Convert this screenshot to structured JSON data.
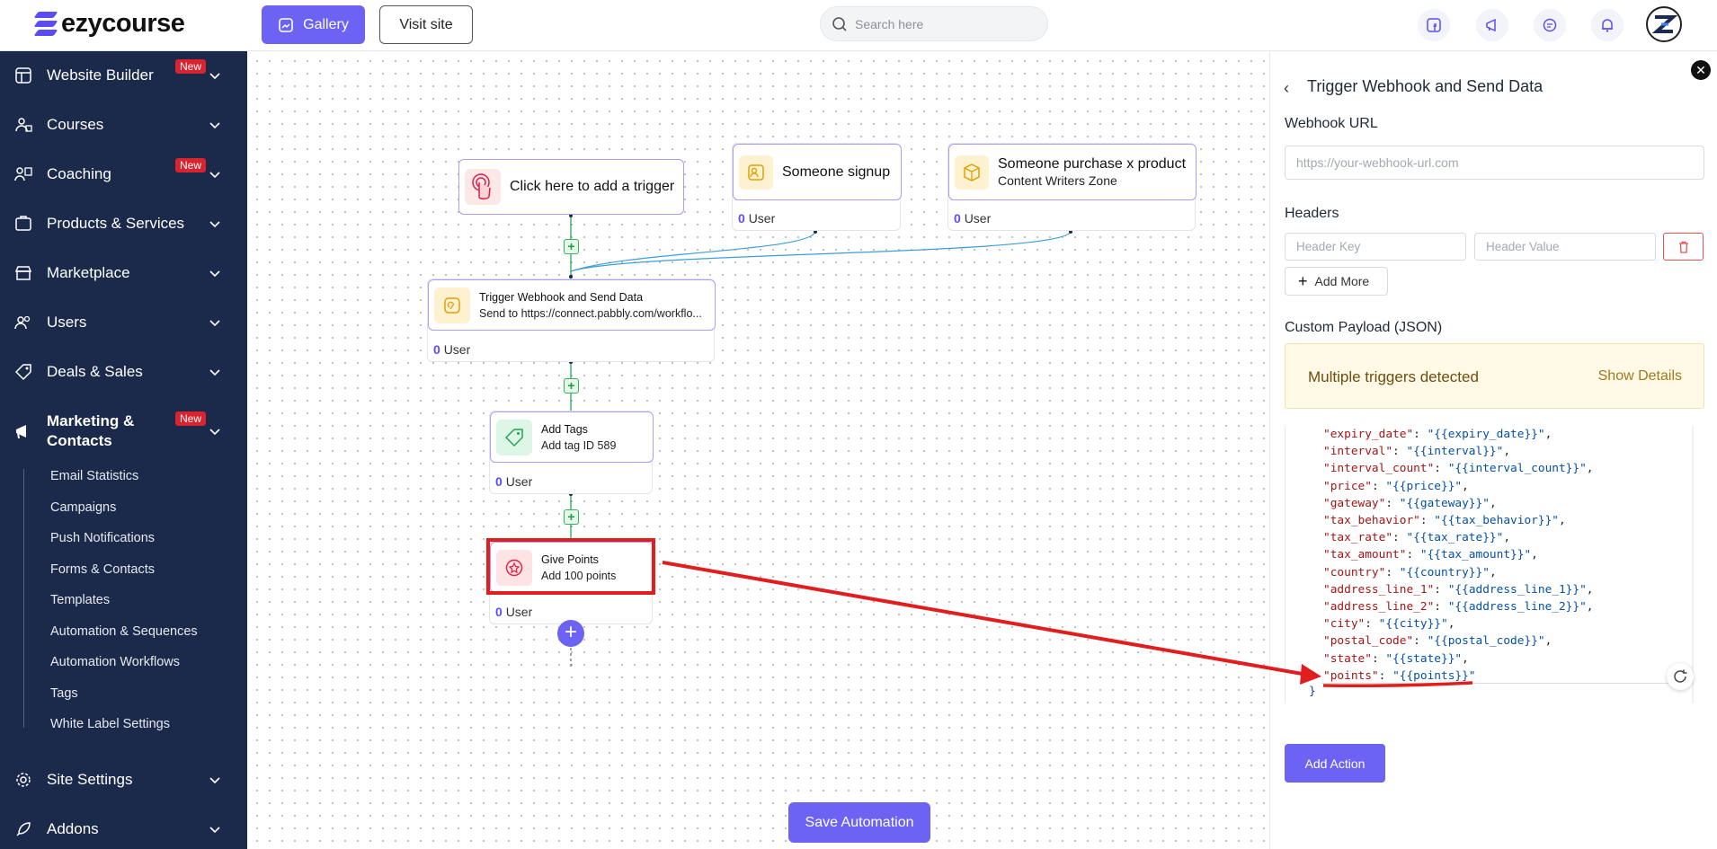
{
  "brand": {
    "name": "ezycourse"
  },
  "topbar": {
    "gallery_label": "Gallery",
    "visit_label": "Visit site",
    "search_placeholder": "Search here"
  },
  "sidebar": {
    "items": [
      {
        "label": "Website Builder",
        "badge": "New"
      },
      {
        "label": "Courses"
      },
      {
        "label": "Coaching",
        "badge": "New"
      },
      {
        "label": "Products & Services"
      },
      {
        "label": "Marketplace"
      },
      {
        "label": "Users"
      },
      {
        "label": "Deals & Sales"
      },
      {
        "label": "Marketing & Contacts",
        "line1": "Marketing &",
        "line2": "Contacts",
        "badge": "New"
      },
      {
        "label": "Site Settings"
      },
      {
        "label": "Addons"
      }
    ],
    "subitems": [
      "Email Statistics",
      "Campaigns",
      "Push Notifications",
      "Forms & Contacts",
      "Templates",
      "Automation & Sequences",
      "Automation Workflows",
      "Tags",
      "White Label Settings"
    ]
  },
  "canvas": {
    "trigger_main": {
      "title": "Click here to add a trigger"
    },
    "trigger_signup": {
      "title": "Someone signup",
      "count": "0",
      "unit": "User"
    },
    "trigger_purchase": {
      "title": "Someone purchase x product",
      "subtitle": "Content Writers Zone",
      "count": "0",
      "unit": "User"
    },
    "webhook": {
      "title": "Trigger Webhook and Send Data",
      "subtitle": "Send to https://connect.pabbly.com/workflo...",
      "count": "0",
      "unit": "User"
    },
    "tags": {
      "title": "Add Tags",
      "subtitle": "Add tag ID 589",
      "count": "0",
      "unit": "User"
    },
    "points": {
      "title": "Give Points",
      "subtitle": "Add 100 points",
      "count": "0",
      "unit": "User"
    },
    "save_label": "Save Automation"
  },
  "panel": {
    "title": "Trigger Webhook and Send Data",
    "webhook_label": "Webhook URL",
    "webhook_placeholder": "https://your-webhook-url.com",
    "headers_label": "Headers",
    "header_key_placeholder": "Header Key",
    "header_value_placeholder": "Header Value",
    "add_more_label": "Add More",
    "payload_label": "Custom Payload (JSON)",
    "warning_text": "Multiple triggers detected",
    "warning_link": "Show Details",
    "code_lines": [
      {
        "k": "\"expiry_date\"",
        "v": "\"{{expiry_date}}\"",
        "end": ","
      },
      {
        "k": "\"interval\"",
        "v": "\"{{interval}}\"",
        "end": ","
      },
      {
        "k": "\"interval_count\"",
        "v": "\"{{interval_count}}\"",
        "end": ","
      },
      {
        "k": "\"price\"",
        "v": "\"{{price}}\"",
        "end": ","
      },
      {
        "k": "\"gateway\"",
        "v": "\"{{gateway}}\"",
        "end": ","
      },
      {
        "k": "\"tax_behavior\"",
        "v": "\"{{tax_behavior}}\"",
        "end": ","
      },
      {
        "k": "\"tax_rate\"",
        "v": "\"{{tax_rate}}\"",
        "end": ","
      },
      {
        "k": "\"tax_amount\"",
        "v": "\"{{tax_amount}}\"",
        "end": ","
      },
      {
        "k": "\"country\"",
        "v": "\"{{country}}\"",
        "end": ","
      },
      {
        "k": "\"address_line_1\"",
        "v": "\"{{address_line_1}}\"",
        "end": ","
      },
      {
        "k": "\"address_line_2\"",
        "v": "\"{{address_line_2}}\"",
        "end": ","
      },
      {
        "k": "\"city\"",
        "v": "\"{{city}}\"",
        "end": ","
      },
      {
        "k": "\"postal_code\"",
        "v": "\"{{postal_code}}\"",
        "end": ","
      },
      {
        "k": "\"state\"",
        "v": "\"{{state}}\"",
        "end": ","
      },
      {
        "k": "\"points\"",
        "v": "\"{{points}}\"",
        "end": ""
      }
    ],
    "code_close": "}",
    "add_action_label": "Add Action"
  },
  "colors": {
    "accent": "#6c63f5",
    "sidebar": "#1b2a4a",
    "annotation": "#e11d1d"
  }
}
